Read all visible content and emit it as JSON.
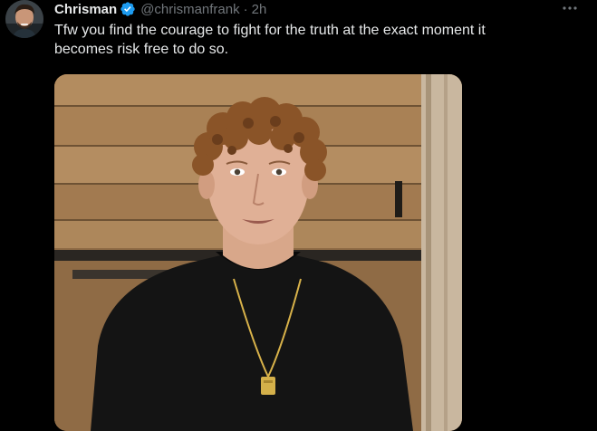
{
  "tweet": {
    "author": {
      "display_name": "Chrisman",
      "handle": "@chrismanfrank",
      "verified_icon": "verified-badge-icon"
    },
    "separator": "·",
    "time_ago": "2h",
    "text": "Tfw you find the courage to fight for the truth at the exact moment it\nbecomes risk free to do so.",
    "more_icon": "more-options-icon",
    "media_type": "video"
  },
  "colors": {
    "background": "#000000",
    "text_primary": "#e7e9ea",
    "text_secondary": "#71767b",
    "verified_blue": "#1d9bf0"
  }
}
